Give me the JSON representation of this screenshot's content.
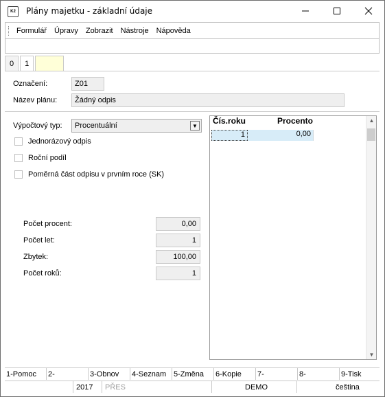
{
  "window": {
    "title": "Plány majetku - základní údaje",
    "icon_text": "K2",
    "controls": {
      "minimize": "minimize",
      "maximize": "maximize",
      "close": "close"
    }
  },
  "menu": {
    "items": [
      "Formulář",
      "Úpravy",
      "Zobrazit",
      "Nástroje",
      "Nápověda"
    ]
  },
  "tabs": [
    {
      "label": "0"
    },
    {
      "label": "1"
    },
    {
      "label": ""
    }
  ],
  "header_fields": {
    "oznaceni_label": "Označení:",
    "oznaceni_value": "Z01",
    "nazev_label": "Název plánu:",
    "nazev_value": "Žádný odpis"
  },
  "settings": {
    "vypoctovy_typ_label": "Výpočtový typ:",
    "vypoctovy_typ_value": "Procentuální",
    "checkboxes": [
      {
        "label": "Jednorázový odpis",
        "checked": false
      },
      {
        "label": "Roční podíl",
        "checked": false
      },
      {
        "label": "Poměrná část odpisu v prvním roce (SK)",
        "checked": false
      }
    ]
  },
  "summary": [
    {
      "label": "Počet procent:",
      "value": "0,00"
    },
    {
      "label": "Počet let:",
      "value": "1"
    },
    {
      "label": "Zbytek:",
      "value": "100,00"
    },
    {
      "label": "Počet roků:",
      "value": "1"
    }
  ],
  "grid": {
    "columns": [
      "Čís.roku",
      "Procento"
    ],
    "rows": [
      {
        "cis_roku": "1",
        "procento": "0,00"
      }
    ]
  },
  "function_keys": [
    "1-Pomoc",
    "2-",
    "3-Obnov",
    "4-Seznam",
    "5-Změna",
    "6-Kopie",
    "7-",
    "8-",
    "9-Tisk"
  ],
  "status_bar": {
    "year": "2017",
    "mode": "PŘES",
    "database": "DEMO",
    "language": "čeština"
  },
  "colors": {
    "selected_row": "#d7ecf8",
    "yellow_tab": "#ffffd8",
    "field_bg": "#efefef"
  }
}
